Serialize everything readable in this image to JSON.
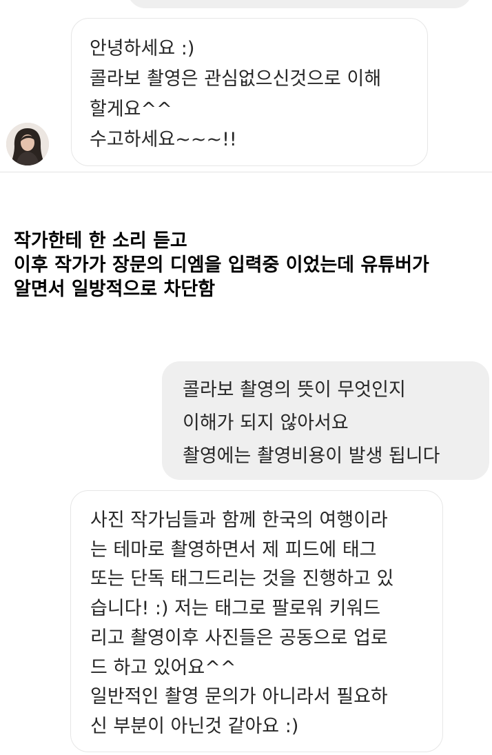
{
  "messages": [
    {
      "direction": "incoming",
      "lines": [
        "안녕하세요 :)",
        "콜라보 촬영은 관심없으신것으로 이해",
        "할게요^^",
        "수고하세요~~~!!"
      ]
    },
    {
      "direction": "outgoing",
      "lines": [
        "콜라보 촬영의 뜻이 무엇인지",
        "이해가 되지 않아서요",
        "촬영에는 촬영비용이 발생 됩니다"
      ]
    },
    {
      "direction": "incoming",
      "lines": [
        "사진 작가님들과 함께 한국의 여행이라",
        "는 테마로 촬영하면서 제 피드에 태그",
        "또는 단독 태그드리는 것을 진행하고 있",
        "습니다! :) 저는 태그로 팔로워 키워드",
        "리고 촬영이후 사진들은 공동으로 업로",
        "드 하고 있어요^^",
        "일반적인 촬영 문의가 아니라서 필요하",
        "신 부분이 아닌것 같아요 :)"
      ]
    }
  ],
  "caption": {
    "lines": [
      "작가한테 한 소리 듣고",
      "이후 작가가 장문의 디엠을 입력중 이었는데 유튜버가",
      "알면서 일방적으로 차단함"
    ]
  },
  "colors": {
    "incoming_bubble_border": "#e6e6e6",
    "outgoing_bubble_bg": "#efefef",
    "message_text": "#262626",
    "caption_text": "#000000"
  },
  "icons": {
    "avatar": "profile-photo"
  }
}
